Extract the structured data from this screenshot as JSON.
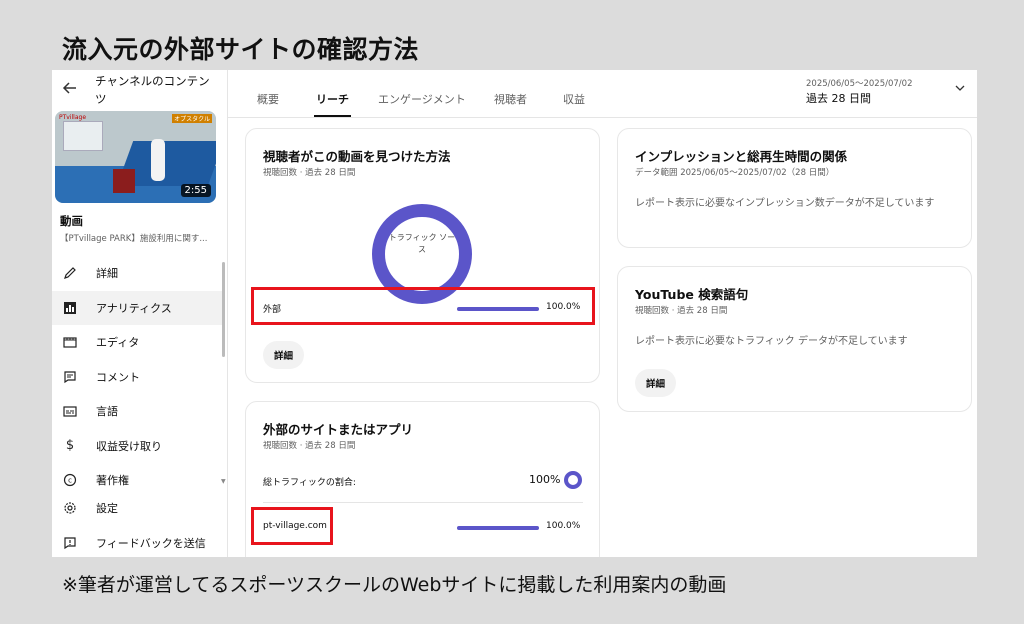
{
  "page_title": "流入元の外部サイトの確認方法",
  "caption": "※筆者が運営してるスポーツスクールのWebサイトに掲載した利用案内の動画",
  "sidebar": {
    "back_icon": "arrow-left-icon",
    "channel_title": "チャンネルのコンテンツ",
    "thumbnail": {
      "brand": "PTvillage",
      "logo": "オプスタクル",
      "duration": "2:55"
    },
    "video_label": "動画",
    "video_name": "【PTvillage PARK】施設利用に関す...",
    "items": [
      {
        "label": "詳細",
        "icon": "pencil-icon"
      },
      {
        "label": "アナリティクス",
        "icon": "analytics-icon",
        "active": true
      },
      {
        "label": "エディタ",
        "icon": "editor-icon"
      },
      {
        "label": "コメント",
        "icon": "comment-icon"
      },
      {
        "label": "言語",
        "icon": "subtitles-icon"
      },
      {
        "label": "収益受け取り",
        "icon": "dollar-icon"
      },
      {
        "label": "著作権",
        "icon": "copyright-icon"
      }
    ],
    "bottom_items": [
      {
        "label": "設定",
        "icon": "gear-icon"
      },
      {
        "label": "フィードバックを送信",
        "icon": "feedback-icon"
      }
    ]
  },
  "tabs": [
    {
      "label": "概要"
    },
    {
      "label": "リーチ",
      "active": true
    },
    {
      "label": "エンゲージメント"
    },
    {
      "label": "視聴者"
    },
    {
      "label": "収益"
    }
  ],
  "date_range": {
    "dates": "2025/06/05〜2025/07/02",
    "label": "過去 28 日間"
  },
  "card_discovery": {
    "title": "視聴者がこの動画を見つけた方法",
    "subtitle": "視聴回数 · 過去 28 日間",
    "donut_label": "トラフィック ソース",
    "rows": [
      {
        "label": "外部",
        "value": "100.0%",
        "fraction": 1.0
      }
    ],
    "button": "詳細",
    "accent": "#5b55c9"
  },
  "card_external": {
    "title": "外部のサイトまたはアプリ",
    "subtitle": "視聴回数 · 過去 28 日間",
    "share_label": "総トラフィックの割合:",
    "share_value": "100%",
    "rows": [
      {
        "label": "pt-village.com",
        "value": "100.0%",
        "fraction": 1.0
      }
    ]
  },
  "card_impressions": {
    "title": "インプレッションと総再生時間の関係",
    "subtitle": "データ範囲 2025/06/05〜2025/07/02（28 日間）",
    "message": "レポート表示に必要なインプレッション数データが不足しています"
  },
  "card_search": {
    "title": "YouTube 検索語句",
    "subtitle": "視聴回数 · 過去 28 日間",
    "message": "レポート表示に必要なトラフィック データが不足しています",
    "button": "詳細"
  },
  "highlight_color": "#e8141c"
}
